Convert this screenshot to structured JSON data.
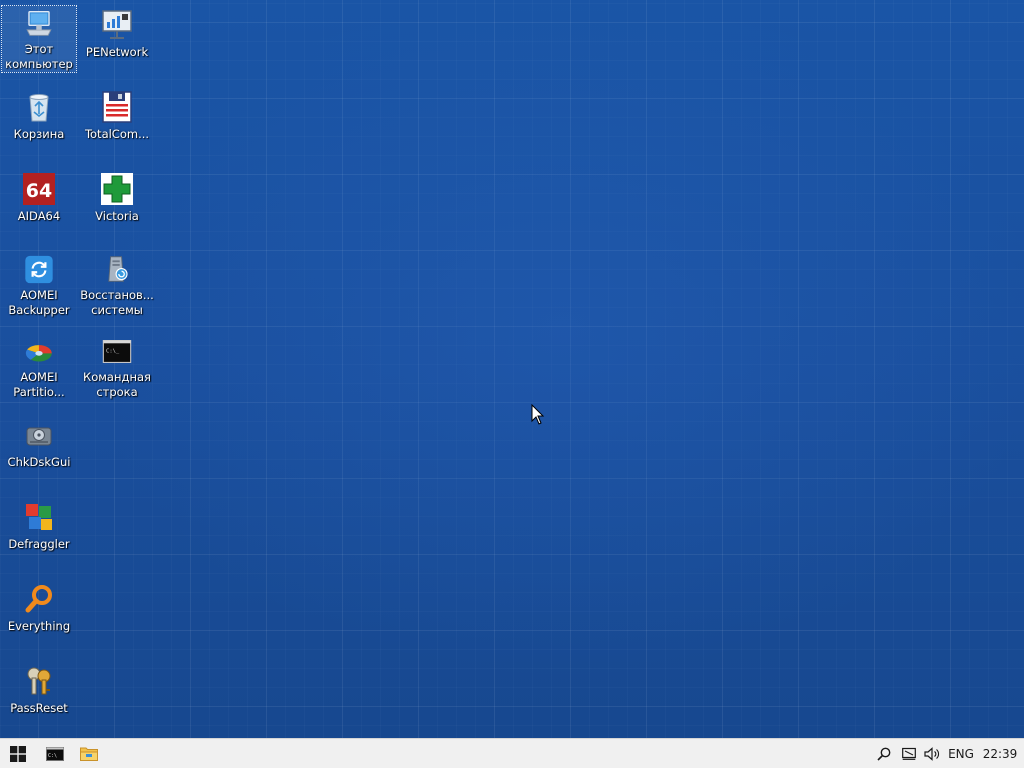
{
  "desktop": {
    "icons": [
      {
        "label": "Этот\nкомпьютер",
        "icon": "computer-icon"
      },
      {
        "label": "Корзина",
        "icon": "recycle-bin-icon"
      },
      {
        "label": "AIDA64",
        "icon": "aida64-icon"
      },
      {
        "label": "AOMEI\nBackupper",
        "icon": "aomei-backupper-icon"
      },
      {
        "label": "AOMEI\nPartitio...",
        "icon": "aomei-partition-icon"
      },
      {
        "label": "ChkDskGui",
        "icon": "chkdskgui-icon"
      },
      {
        "label": "Defraggler",
        "icon": "defraggler-icon"
      },
      {
        "label": "Everything",
        "icon": "everything-icon"
      },
      {
        "label": "PassReset",
        "icon": "passreset-icon"
      },
      {
        "label": "PENetwork",
        "icon": "penetwork-icon"
      },
      {
        "label": "TotalCom...",
        "icon": "totalcommander-icon"
      },
      {
        "label": "Victoria",
        "icon": "victoria-icon"
      },
      {
        "label": "Восстанов...\nсистемы",
        "icon": "system-restore-icon"
      },
      {
        "label": "Командная\nстрока",
        "icon": "command-prompt-icon"
      }
    ]
  },
  "taskbar": {
    "start_icon": "windows-start-icon",
    "pinned": [
      {
        "icon": "command-prompt-icon"
      },
      {
        "icon": "file-explorer-icon"
      }
    ],
    "tray": {
      "search_icon": "search-icon",
      "network_icon": "network-icon",
      "volume_icon": "volume-icon",
      "language": "ENG",
      "clock": "22:39"
    }
  },
  "colors": {
    "desktop_background": "#1a4f9e",
    "taskbar_background": "#f0f0f0"
  }
}
